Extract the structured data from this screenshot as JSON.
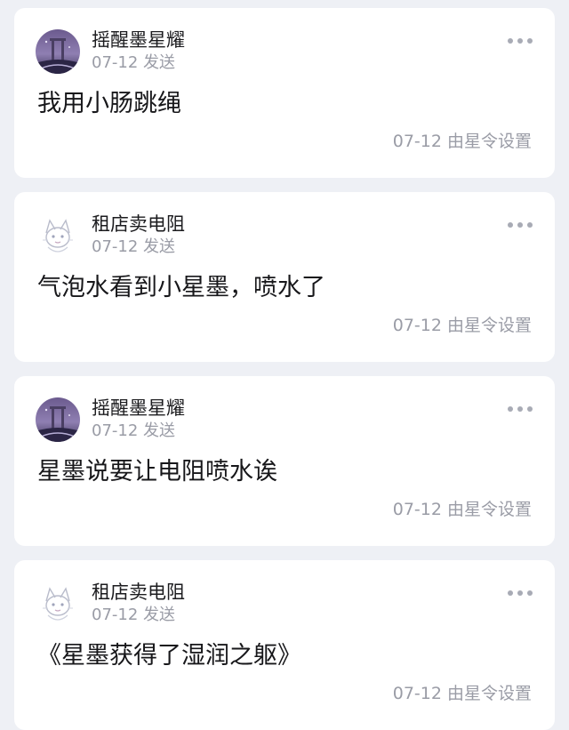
{
  "messages": [
    {
      "author": "摇醒墨星耀",
      "avatar_icon": "purple-night-avatar-icon",
      "sent": "07-12 发送",
      "content": "我用小肠跳绳",
      "set_info": "07-12 由星令设置"
    },
    {
      "author": "租店卖电阻",
      "avatar_icon": "sketch-fox-avatar-icon",
      "sent": "07-12 发送",
      "content": "气泡水看到小星墨，喷水了",
      "set_info": "07-12 由星令设置"
    },
    {
      "author": "摇醒墨星耀",
      "avatar_icon": "purple-night-avatar-icon",
      "sent": "07-12 发送",
      "content": "星墨说要让电阻喷水诶",
      "set_info": "07-12 由星令设置"
    },
    {
      "author": "租店卖电阻",
      "avatar_icon": "sketch-fox-avatar-icon",
      "sent": "07-12 发送",
      "content": "《星墨获得了湿润之躯》",
      "set_info": "07-12 由星令设置"
    }
  ],
  "colors": {
    "background": "#eef0f5",
    "card": "#ffffff",
    "text_primary": "#17171a",
    "text_secondary": "#9a9ca6",
    "more_dots": "#a8abb5"
  },
  "icons": {
    "more": "more-dots-icon"
  }
}
